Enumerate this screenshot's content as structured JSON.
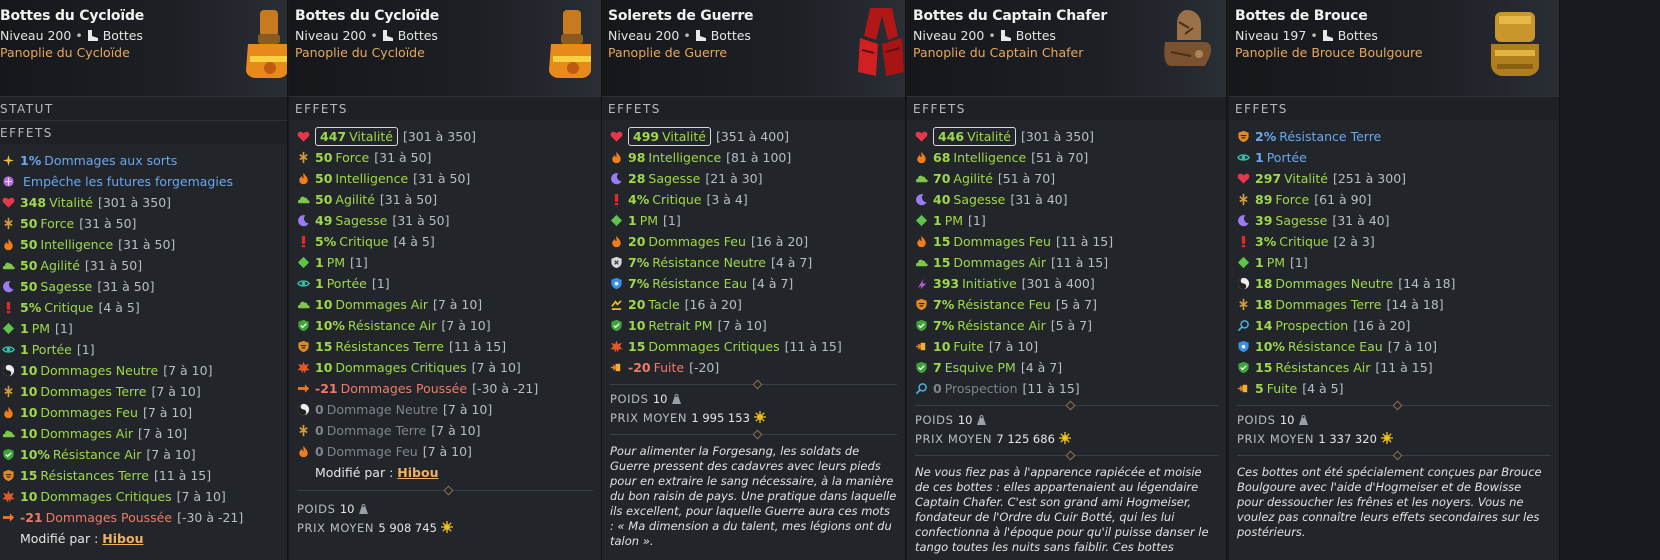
{
  "panels": [
    {
      "name": "Bottes du Cycloïde",
      "level": "Niveau 200",
      "type": "Bottes",
      "set": "Panoplie du Cycloïde",
      "section_statut": "STATUT",
      "section_effets": "EFFETS",
      "effects": [
        {
          "icon": "spark",
          "v": "1%",
          "l": "Dommages aux sorts",
          "r": "",
          "c": "b"
        },
        {
          "icon": "forgemagie",
          "v": "",
          "l": "Empêche les futures forgemagies",
          "r": "",
          "c": "b"
        },
        {
          "icon": "heart",
          "v": "348",
          "l": "Vitalité",
          "r": "[301 à 350]",
          "c": "g"
        },
        {
          "icon": "force",
          "v": "50",
          "l": "Force",
          "r": "[31 à 50]",
          "c": "g"
        },
        {
          "icon": "fire",
          "v": "50",
          "l": "Intelligence",
          "r": "[31 à 50]",
          "c": "g"
        },
        {
          "icon": "cloud",
          "v": "50",
          "l": "Agilité",
          "r": "[31 à 50]",
          "c": "g"
        },
        {
          "icon": "moon",
          "v": "50",
          "l": "Sagesse",
          "r": "[31 à 50]",
          "c": "g"
        },
        {
          "icon": "crit",
          "v": "5%",
          "l": "Critique",
          "r": "[4 à 5]",
          "c": "g"
        },
        {
          "icon": "pm",
          "v": "1",
          "l": "PM",
          "r": "[1]",
          "c": "g"
        },
        {
          "icon": "eye",
          "v": "1",
          "l": "Portée",
          "r": "[1]",
          "c": "g"
        },
        {
          "icon": "yinyang",
          "v": "10",
          "l": "Dommages Neutre",
          "r": "[7 à 10]",
          "c": "g"
        },
        {
          "icon": "force",
          "v": "10",
          "l": "Dommages Terre",
          "r": "[7 à 10]",
          "c": "g"
        },
        {
          "icon": "fire",
          "v": "10",
          "l": "Dommages Feu",
          "r": "[7 à 10]",
          "c": "g"
        },
        {
          "icon": "cloud",
          "v": "10",
          "l": "Dommages Air",
          "r": "[7 à 10]",
          "c": "g"
        },
        {
          "icon": "shield-green",
          "v": "10%",
          "l": "Résistance Air",
          "r": "[7 à 10]",
          "c": "g"
        },
        {
          "icon": "shield-orange",
          "v": "15",
          "l": "Résistances Terre",
          "r": "[11 à 15]",
          "c": "g"
        },
        {
          "icon": "burst",
          "v": "10",
          "l": "Dommages Critiques",
          "r": "[7 à 10]",
          "c": "g"
        },
        {
          "icon": "arrow",
          "v": "-21",
          "l": "Dommages Poussée",
          "r": "[-30 à -21]",
          "c": "r"
        }
      ],
      "modified_label": "Modifié par :",
      "modified_by": "Hibou"
    },
    {
      "name": "Bottes du Cycloïde",
      "level": "Niveau 200",
      "type": "Bottes",
      "set": "Panoplie du Cycloïde",
      "section_effets": "EFFETS",
      "effects": [
        {
          "icon": "heart",
          "v": "447",
          "l": "Vitalité",
          "r": "[301 à 350]",
          "c": "g",
          "boxed": true
        },
        {
          "icon": "force",
          "v": "50",
          "l": "Force",
          "r": "[31 à 50]",
          "c": "g"
        },
        {
          "icon": "fire",
          "v": "50",
          "l": "Intelligence",
          "r": "[31 à 50]",
          "c": "g"
        },
        {
          "icon": "cloud",
          "v": "50",
          "l": "Agilité",
          "r": "[31 à 50]",
          "c": "g"
        },
        {
          "icon": "moon",
          "v": "49",
          "l": "Sagesse",
          "r": "[31 à 50]",
          "c": "g"
        },
        {
          "icon": "crit",
          "v": "5%",
          "l": "Critique",
          "r": "[4 à 5]",
          "c": "g"
        },
        {
          "icon": "pm",
          "v": "1",
          "l": "PM",
          "r": "[1]",
          "c": "g"
        },
        {
          "icon": "eye",
          "v": "1",
          "l": "Portée",
          "r": "[1]",
          "c": "g"
        },
        {
          "icon": "cloud",
          "v": "10",
          "l": "Dommages Air",
          "r": "[7 à 10]",
          "c": "g"
        },
        {
          "icon": "shield-green",
          "v": "10%",
          "l": "Résistance Air",
          "r": "[7 à 10]",
          "c": "g"
        },
        {
          "icon": "shield-orange",
          "v": "15",
          "l": "Résistances Terre",
          "r": "[11 à 15]",
          "c": "g"
        },
        {
          "icon": "burst",
          "v": "10",
          "l": "Dommages Critiques",
          "r": "[7 à 10]",
          "c": "g"
        },
        {
          "icon": "arrow",
          "v": "-21",
          "l": "Dommages Poussée",
          "r": "[-30 à -21]",
          "c": "r"
        },
        {
          "icon": "yinyang",
          "v": "0",
          "l": "Dommage Neutre",
          "r": "[7 à 10]",
          "c": "d"
        },
        {
          "icon": "force",
          "v": "0",
          "l": "Dommage Terre",
          "r": "[7 à 10]",
          "c": "d"
        },
        {
          "icon": "fire",
          "v": "0",
          "l": "Dommage Feu",
          "r": "[7 à 10]",
          "c": "d"
        }
      ],
      "modified_label": "Modifié par :",
      "modified_by": "Hibou",
      "weight_label": "POIDS",
      "weight": "10",
      "price_label": "PRIX MOYEN",
      "price": "5 908 745"
    },
    {
      "name": "Solerets de Guerre",
      "level": "Niveau 200",
      "type": "Bottes",
      "set": "Panoplie de Guerre",
      "section_effets": "EFFETS",
      "effects": [
        {
          "icon": "heart",
          "v": "499",
          "l": "Vitalité",
          "r": "[351 à 400]",
          "c": "g",
          "boxed": true
        },
        {
          "icon": "fire",
          "v": "98",
          "l": "Intelligence",
          "r": "[81 à 100]",
          "c": "g"
        },
        {
          "icon": "moon",
          "v": "28",
          "l": "Sagesse",
          "r": "[21 à 30]",
          "c": "g"
        },
        {
          "icon": "crit",
          "v": "4%",
          "l": "Critique",
          "r": "[3 à 4]",
          "c": "g"
        },
        {
          "icon": "pm",
          "v": "1",
          "l": "PM",
          "r": "[1]",
          "c": "g"
        },
        {
          "icon": "fire",
          "v": "20",
          "l": "Dommages Feu",
          "r": "[16 à 20]",
          "c": "g"
        },
        {
          "icon": "shield-white",
          "v": "7%",
          "l": "Résistance Neutre",
          "r": "[4 à 7]",
          "c": "g"
        },
        {
          "icon": "shield-blue",
          "v": "7%",
          "l": "Résistance Eau",
          "r": "[4 à 7]",
          "c": "g"
        },
        {
          "icon": "tacle",
          "v": "20",
          "l": "Tacle",
          "r": "[16 à 20]",
          "c": "g"
        },
        {
          "icon": "shield-green",
          "v": "10",
          "l": "Retrait PM",
          "r": "[7 à 10]",
          "c": "g"
        },
        {
          "icon": "burst",
          "v": "15",
          "l": "Dommages Critiques",
          "r": "[11 à 15]",
          "c": "g"
        },
        {
          "icon": "flee",
          "v": "-20",
          "l": "Fuite",
          "r": "[-20]",
          "c": "r"
        }
      ],
      "weight_label": "POIDS",
      "weight": "10",
      "price_label": "PRIX MOYEN",
      "price": "1 995 153",
      "description": "Pour alimenter la Forgesang, les soldats de Guerre pressent des cadavres avec leurs pieds pour en extraire le sang nécessaire, à la manière du bon raisin de pays. Une pratique dans laquelle ils excellent, pour laquelle Guerre aura ces mots : « Ma dimension a du talent, mes légions ont du talon »."
    },
    {
      "name": "Bottes du Captain Chafer",
      "level": "Niveau 200",
      "type": "Bottes",
      "set": "Panoplie du Captain Chafer",
      "section_effets": "EFFETS",
      "effects": [
        {
          "icon": "heart",
          "v": "446",
          "l": "Vitalité",
          "r": "[301 à 350]",
          "c": "g",
          "boxed": true
        },
        {
          "icon": "fire",
          "v": "68",
          "l": "Intelligence",
          "r": "[51 à 70]",
          "c": "g"
        },
        {
          "icon": "cloud",
          "v": "70",
          "l": "Agilité",
          "r": "[51 à 70]",
          "c": "g"
        },
        {
          "icon": "moon",
          "v": "40",
          "l": "Sagesse",
          "r": "[31 à 40]",
          "c": "g"
        },
        {
          "icon": "pm",
          "v": "1",
          "l": "PM",
          "r": "[1]",
          "c": "g"
        },
        {
          "icon": "fire",
          "v": "15",
          "l": "Dommages Feu",
          "r": "[11 à 15]",
          "c": "g"
        },
        {
          "icon": "cloud",
          "v": "15",
          "l": "Dommages Air",
          "r": "[11 à 15]",
          "c": "g"
        },
        {
          "icon": "initiative",
          "v": "393",
          "l": "Initiative",
          "r": "[301 à 400]",
          "c": "g"
        },
        {
          "icon": "shield-orange",
          "v": "7%",
          "l": "Résistance Feu",
          "r": "[5 à 7]",
          "c": "g"
        },
        {
          "icon": "shield-green",
          "v": "7%",
          "l": "Résistance Air",
          "r": "[5 à 7]",
          "c": "g"
        },
        {
          "icon": "flee",
          "v": "10",
          "l": "Fuite",
          "r": "[7 à 10]",
          "c": "g"
        },
        {
          "icon": "shield-green",
          "v": "7",
          "l": "Esquive PM",
          "r": "[4 à 7]",
          "c": "g"
        },
        {
          "icon": "search",
          "v": "0",
          "l": "Prospection",
          "r": "[11 à 15]",
          "c": "d"
        }
      ],
      "weight_label": "POIDS",
      "weight": "10",
      "price_label": "PRIX MOYEN",
      "price": "7 125 686",
      "description": "Ne vous fiez pas à l'apparence rapiécée et moisie de ces bottes : elles appartenaient au légendaire Captain Chafer. C'est son grand ami Hogmeiser, fondateur de l'Ordre du Cuir Botté, qui les lui confectionna à l'époque pour qu'il puisse danser le tango toutes les nuits sans faiblir. Ces bottes"
    },
    {
      "name": "Bottes de Brouce",
      "level": "Niveau 197",
      "type": "Bottes",
      "set": "Panoplie de Brouce Boulgoure",
      "section_effets": "EFFETS",
      "effects": [
        {
          "icon": "shield-orange",
          "v": "2%",
          "l": "Résistance Terre",
          "r": "",
          "c": "b"
        },
        {
          "icon": "eye",
          "v": "1",
          "l": "Portée",
          "r": "",
          "c": "b"
        },
        {
          "icon": "heart",
          "v": "297",
          "l": "Vitalité",
          "r": "[251 à 300]",
          "c": "g"
        },
        {
          "icon": "force",
          "v": "89",
          "l": "Force",
          "r": "[61 à 90]",
          "c": "g"
        },
        {
          "icon": "moon",
          "v": "39",
          "l": "Sagesse",
          "r": "[31 à 40]",
          "c": "g"
        },
        {
          "icon": "crit",
          "v": "3%",
          "l": "Critique",
          "r": "[2 à 3]",
          "c": "g"
        },
        {
          "icon": "pm",
          "v": "1",
          "l": "PM",
          "r": "[1]",
          "c": "g"
        },
        {
          "icon": "yinyang",
          "v": "18",
          "l": "Dommages Neutre",
          "r": "[14 à 18]",
          "c": "g"
        },
        {
          "icon": "force",
          "v": "18",
          "l": "Dommages Terre",
          "r": "[14 à 18]",
          "c": "g"
        },
        {
          "icon": "search",
          "v": "14",
          "l": "Prospection",
          "r": "[16 à 20]",
          "c": "g"
        },
        {
          "icon": "shield-blue",
          "v": "10%",
          "l": "Résistance Eau",
          "r": "[7 à 10]",
          "c": "g"
        },
        {
          "icon": "shield-green",
          "v": "15",
          "l": "Résistances Air",
          "r": "[11 à 15]",
          "c": "g"
        },
        {
          "icon": "flee",
          "v": "5",
          "l": "Fuite",
          "r": "[4 à 5]",
          "c": "g"
        }
      ],
      "weight_label": "POIDS",
      "weight": "10",
      "price_label": "PRIX MOYEN",
      "price": "1 337 320",
      "description": "Ces bottes ont été spécialement conçues par Brouce Boulgoure avec l'aide d'Hogmeiser et de Bowisse pour dessoucher les frênes et les noyers. Vous ne voulez pas connaître leurs effets secondaires sur les postérieurs."
    }
  ]
}
